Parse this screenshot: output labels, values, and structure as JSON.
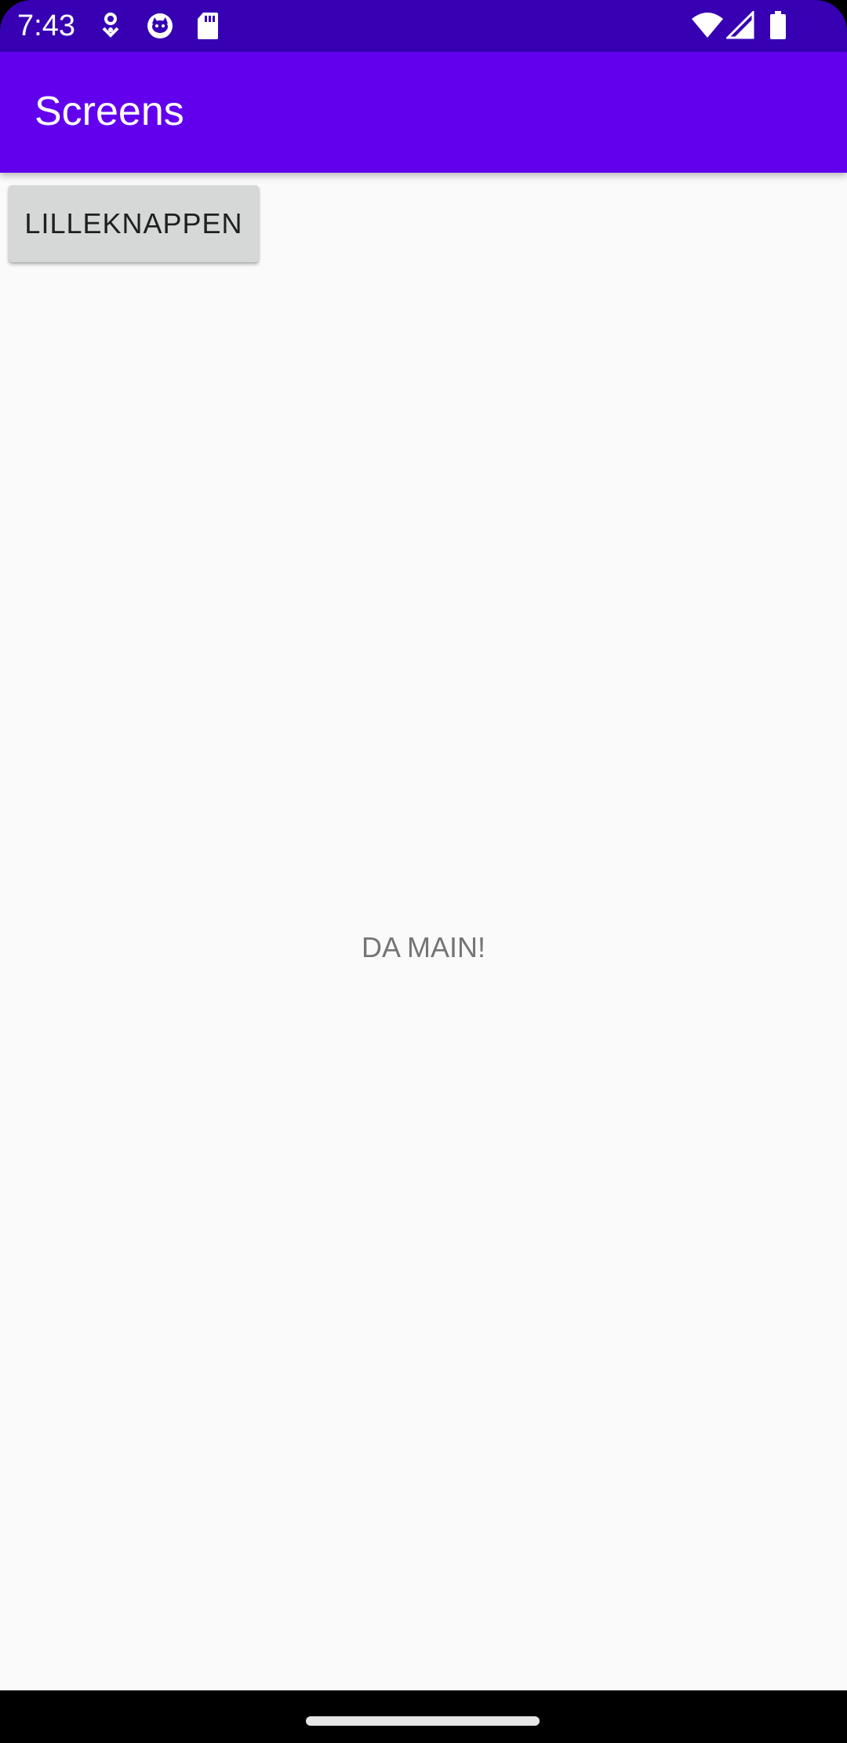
{
  "status_bar": {
    "time": "7:43",
    "background": "#3700B3",
    "left_icons": [
      "location-pin-icon",
      "cat-face-icon",
      "sd-card-icon"
    ],
    "right_icons": [
      "wifi-icon",
      "cell-signal-icon",
      "battery-icon"
    ]
  },
  "app_bar": {
    "title": "Screens",
    "background": "#6200EE"
  },
  "main": {
    "button_label": "LILLEKNAPPEN",
    "center_text": "DA MAIN!",
    "background": "#FAFAFA"
  },
  "nav_bar": {
    "handle": "home-gesture-handle"
  }
}
